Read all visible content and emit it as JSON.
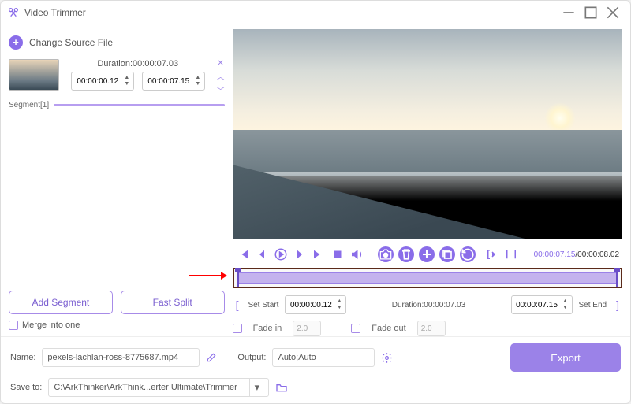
{
  "app": {
    "title": "Video Trimmer"
  },
  "source": {
    "change_label": "Change Source File"
  },
  "segment": {
    "duration_label": "Duration:00:00:07.03",
    "start": "00:00:00.12",
    "end": "00:00:07.15",
    "name": "Segment[1]"
  },
  "buttons": {
    "add_segment": "Add Segment",
    "fast_split": "Fast Split",
    "merge": "Merge into one",
    "export": "Export"
  },
  "playback": {
    "current": "00:00:07.15",
    "total": "00:00:08.02"
  },
  "trim": {
    "set_start": "Set Start",
    "start_val": "00:00:00.12",
    "duration_label": "Duration:00:00:07.03",
    "end_val": "00:00:07.15",
    "set_end": "Set End"
  },
  "fade": {
    "in_label": "Fade in",
    "in_val": "2.0",
    "out_label": "Fade out",
    "out_val": "2.0"
  },
  "footer": {
    "name_label": "Name:",
    "name_val": "pexels-lachlan-ross-8775687.mp4",
    "output_label": "Output:",
    "output_val": "Auto;Auto",
    "save_label": "Save to:",
    "save_val": "C:\\ArkThinker\\ArkThink...erter Ultimate\\Trimmer"
  }
}
